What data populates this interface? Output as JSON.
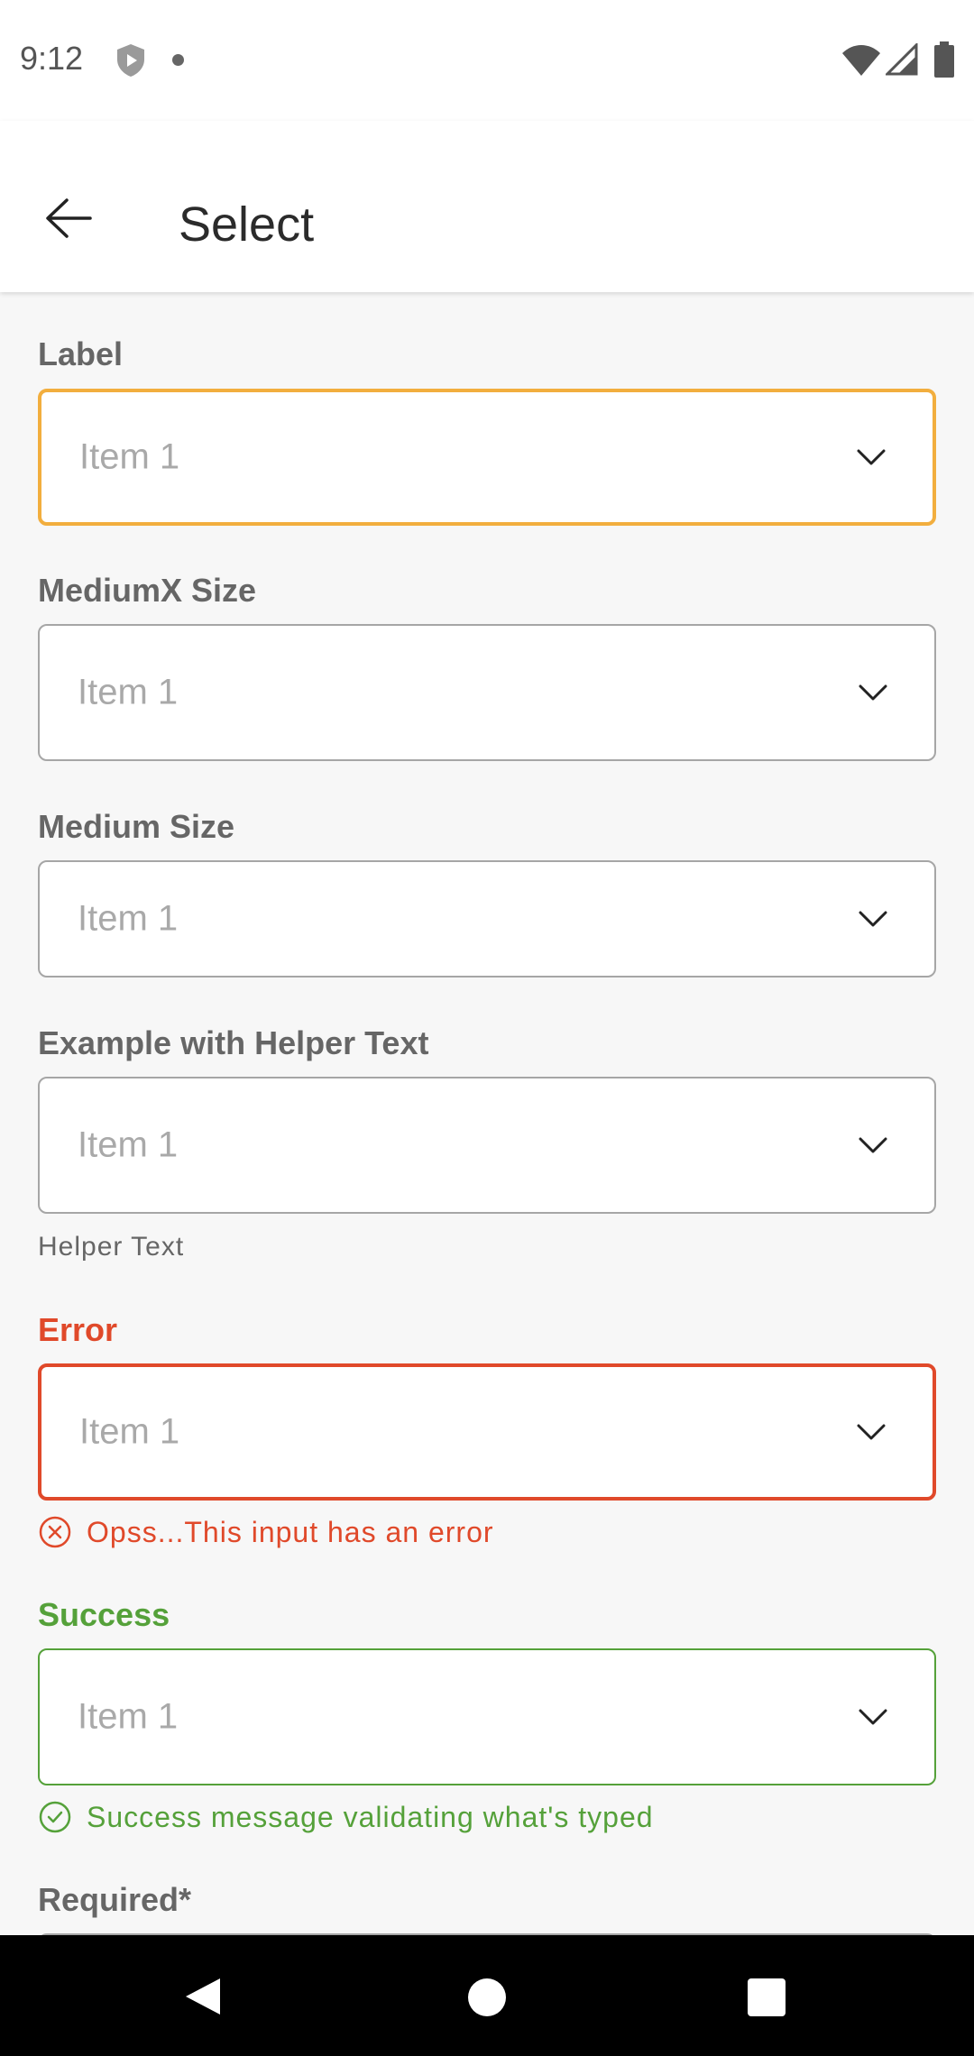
{
  "status": {
    "time": "9:12"
  },
  "appbar": {
    "title": "Select"
  },
  "colors": {
    "focus": "#f2ae3e",
    "error": "#e0492a",
    "success": "#55a13a",
    "border": "#a6a6a6"
  },
  "fields": [
    {
      "label": "Label",
      "value": "Item 1",
      "state": "focused"
    },
    {
      "label": "MediumX Size",
      "value": "Item 1",
      "state": "default"
    },
    {
      "label": "Medium Size",
      "value": "Item 1",
      "state": "default"
    },
    {
      "label": "Example with Helper Text",
      "value": "Item 1",
      "helper": "Helper Text"
    },
    {
      "label": "Error",
      "value": "Item 1",
      "state": "error",
      "message": "Opss...This input has an error"
    },
    {
      "label": "Success",
      "value": "Item 1",
      "state": "success",
      "message": "Success message validating what's typed"
    },
    {
      "label": "Required*",
      "value": ""
    }
  ]
}
